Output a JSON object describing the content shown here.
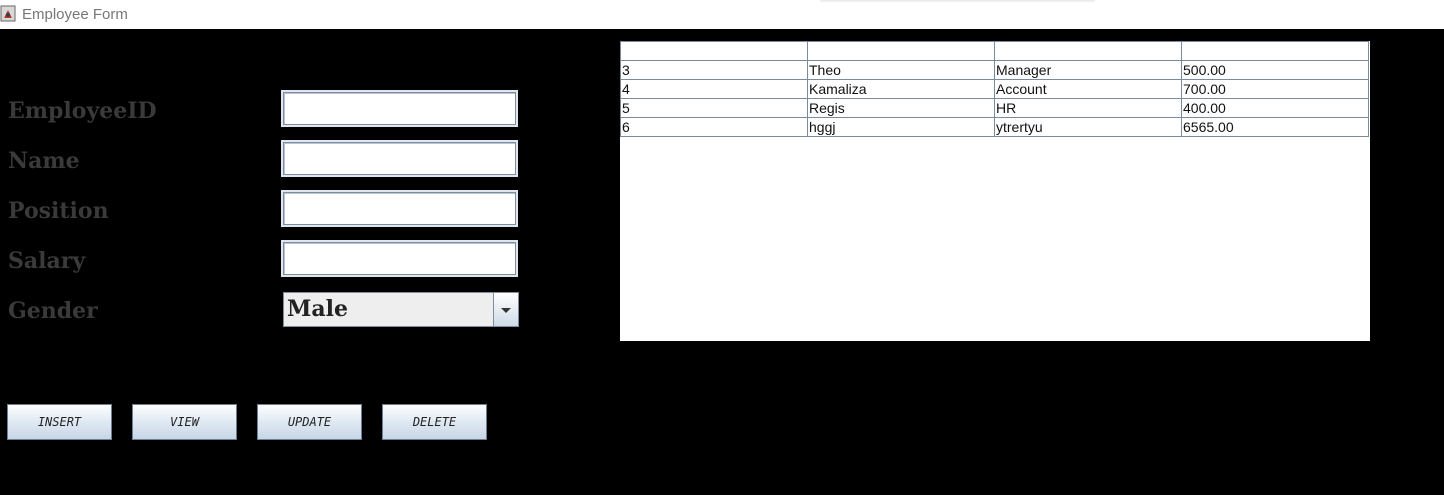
{
  "window": {
    "title": "Employee Form"
  },
  "form": {
    "fields": [
      {
        "label": "EmployeeID",
        "value": ""
      },
      {
        "label": "Name",
        "value": ""
      },
      {
        "label": "Position",
        "value": ""
      },
      {
        "label": "Salary",
        "value": ""
      }
    ],
    "gender": {
      "label": "Gender",
      "selected": "Male"
    }
  },
  "buttons": {
    "insert": "INSERT",
    "view": "VIEW",
    "update": "UPDATE",
    "delete": "DELETE"
  },
  "table": {
    "headers": [
      "",
      "",
      "",
      ""
    ],
    "rows": [
      [
        "3",
        "Theo",
        "Manager",
        "500.00"
      ],
      [
        "4",
        "Kamaliza",
        "Account",
        "700.00"
      ],
      [
        "5",
        "Regis",
        "HR",
        "400.00"
      ],
      [
        "6",
        "hggj",
        "ytrertyu",
        "6565.00"
      ]
    ]
  }
}
